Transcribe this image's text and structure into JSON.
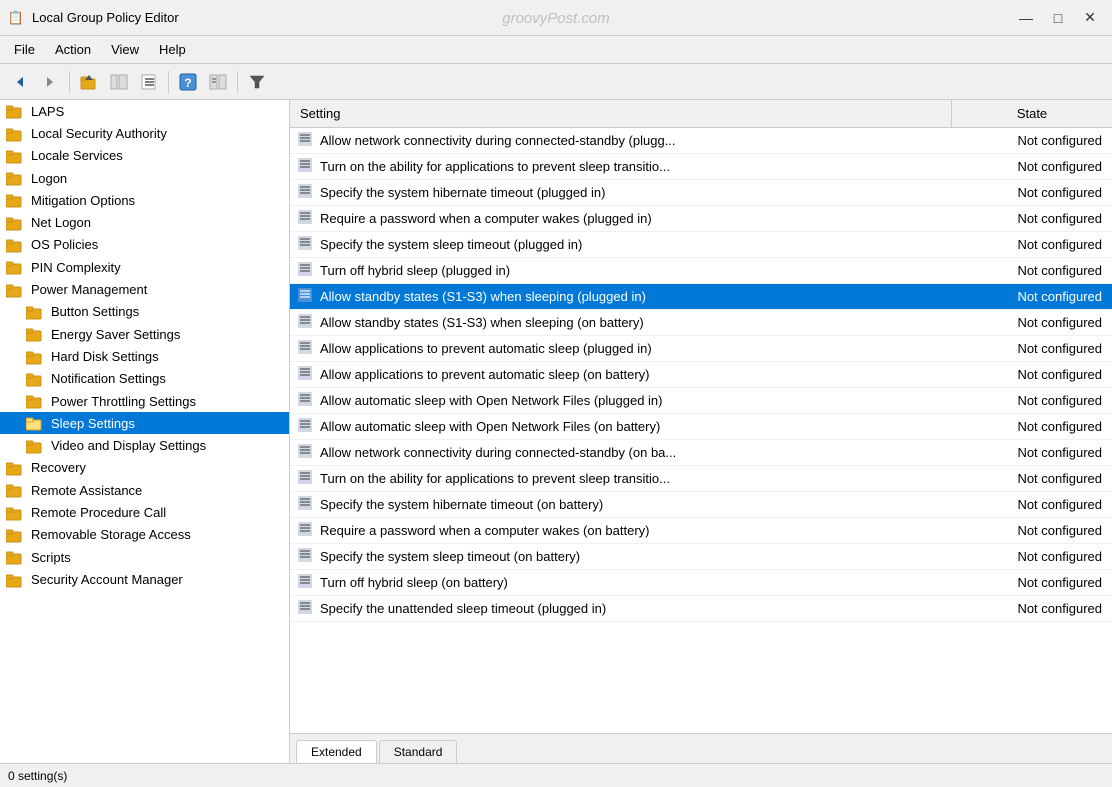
{
  "titleBar": {
    "appIcon": "📋",
    "title": "Local Group Policy Editor",
    "watermark": "groovyPost.com",
    "controls": {
      "minimize": "—",
      "maximize": "□",
      "close": "✕"
    }
  },
  "menuBar": {
    "items": [
      "File",
      "Action",
      "View",
      "Help"
    ]
  },
  "toolbar": {
    "buttons": [
      {
        "name": "back",
        "icon": "◀"
      },
      {
        "name": "forward",
        "icon": "▶"
      },
      {
        "name": "up",
        "icon": "📁"
      },
      {
        "name": "show-hide-tree",
        "icon": "🗂"
      },
      {
        "name": "show",
        "icon": "📄"
      },
      {
        "name": "help",
        "icon": "❓"
      },
      {
        "name": "extended",
        "icon": "📋"
      },
      {
        "name": "filter",
        "icon": "⧩"
      }
    ]
  },
  "sidebar": {
    "items": [
      {
        "label": "LAPS",
        "indent": 0,
        "hasFolder": false,
        "icon": "📁"
      },
      {
        "label": "Local Security Authority",
        "indent": 0,
        "hasFolder": false,
        "icon": "📁"
      },
      {
        "label": "Locale Services",
        "indent": 0,
        "hasFolder": false,
        "icon": "📁"
      },
      {
        "label": "Logon",
        "indent": 0,
        "hasFolder": false,
        "icon": "📁"
      },
      {
        "label": "Mitigation Options",
        "indent": 0,
        "hasFolder": false,
        "icon": "📁"
      },
      {
        "label": "Net Logon",
        "indent": 0,
        "hasFolder": false,
        "icon": "📁"
      },
      {
        "label": "OS Policies",
        "indent": 0,
        "hasFolder": false,
        "icon": "📁"
      },
      {
        "label": "PIN Complexity",
        "indent": 0,
        "hasFolder": false,
        "icon": "📁"
      },
      {
        "label": "Power Management",
        "indent": 0,
        "hasFolder": false,
        "icon": "📁"
      },
      {
        "label": "Button Settings",
        "indent": 1,
        "hasFolder": true,
        "icon": "📁"
      },
      {
        "label": "Energy Saver Settings",
        "indent": 1,
        "hasFolder": true,
        "icon": "📁"
      },
      {
        "label": "Hard Disk Settings",
        "indent": 1,
        "hasFolder": true,
        "icon": "📁"
      },
      {
        "label": "Notification Settings",
        "indent": 1,
        "hasFolder": true,
        "icon": "📁"
      },
      {
        "label": "Power Throttling Settings",
        "indent": 1,
        "hasFolder": true,
        "icon": "📁"
      },
      {
        "label": "Sleep Settings",
        "indent": 1,
        "hasFolder": true,
        "icon": "📁",
        "selected": true
      },
      {
        "label": "Video and Display Settings",
        "indent": 1,
        "hasFolder": true,
        "icon": "📁"
      },
      {
        "label": "Recovery",
        "indent": 0,
        "hasFolder": false,
        "icon": "📁"
      },
      {
        "label": "Remote Assistance",
        "indent": 0,
        "hasFolder": false,
        "icon": "📁"
      },
      {
        "label": "Remote Procedure Call",
        "indent": 0,
        "hasFolder": false,
        "icon": "📁"
      },
      {
        "label": "Removable Storage Access",
        "indent": 0,
        "hasFolder": false,
        "icon": "📁"
      },
      {
        "label": "Scripts",
        "indent": 0,
        "hasFolder": false,
        "icon": "📁"
      },
      {
        "label": "Security Account Manager",
        "indent": 0,
        "hasFolder": false,
        "icon": "📁"
      }
    ]
  },
  "table": {
    "headers": {
      "setting": "Setting",
      "state": "State"
    },
    "rows": [
      {
        "setting": "Allow network connectivity during connected-standby (plugg...",
        "state": "Not configured",
        "highlighted": false
      },
      {
        "setting": "Turn on the ability for applications to prevent sleep transitio...",
        "state": "Not configured",
        "highlighted": false
      },
      {
        "setting": "Specify the system hibernate timeout (plugged in)",
        "state": "Not configured",
        "highlighted": false
      },
      {
        "setting": "Require a password when a computer wakes (plugged in)",
        "state": "Not configured",
        "highlighted": false
      },
      {
        "setting": "Specify the system sleep timeout (plugged in)",
        "state": "Not configured",
        "highlighted": false
      },
      {
        "setting": "Turn off hybrid sleep (plugged in)",
        "state": "Not configured",
        "highlighted": false
      },
      {
        "setting": "Allow standby states (S1-S3) when sleeping (plugged in)",
        "state": "Not configured",
        "highlighted": true
      },
      {
        "setting": "Allow standby states (S1-S3) when sleeping (on battery)",
        "state": "Not configured",
        "highlighted": false
      },
      {
        "setting": "Allow applications to prevent automatic sleep (plugged in)",
        "state": "Not configured",
        "highlighted": false
      },
      {
        "setting": "Allow applications to prevent automatic sleep (on battery)",
        "state": "Not configured",
        "highlighted": false
      },
      {
        "setting": "Allow automatic sleep with Open Network Files (plugged in)",
        "state": "Not configured",
        "highlighted": false
      },
      {
        "setting": "Allow automatic sleep with Open Network Files (on battery)",
        "state": "Not configured",
        "highlighted": false
      },
      {
        "setting": "Allow network connectivity during connected-standby (on ba...",
        "state": "Not configured",
        "highlighted": false
      },
      {
        "setting": "Turn on the ability for applications to prevent sleep transitio...",
        "state": "Not configured",
        "highlighted": false
      },
      {
        "setting": "Specify the system hibernate timeout (on battery)",
        "state": "Not configured",
        "highlighted": false
      },
      {
        "setting": "Require a password when a computer wakes (on battery)",
        "state": "Not configured",
        "highlighted": false
      },
      {
        "setting": "Specify the system sleep timeout (on battery)",
        "state": "Not configured",
        "highlighted": false
      },
      {
        "setting": "Turn off hybrid sleep (on battery)",
        "state": "Not configured",
        "highlighted": false
      },
      {
        "setting": "Specify the unattended sleep timeout (plugged in)",
        "state": "Not configured",
        "highlighted": false
      }
    ]
  },
  "tabs": [
    {
      "label": "Extended",
      "active": true
    },
    {
      "label": "Standard",
      "active": false
    }
  ],
  "statusBar": {
    "text": "0 setting(s)"
  }
}
